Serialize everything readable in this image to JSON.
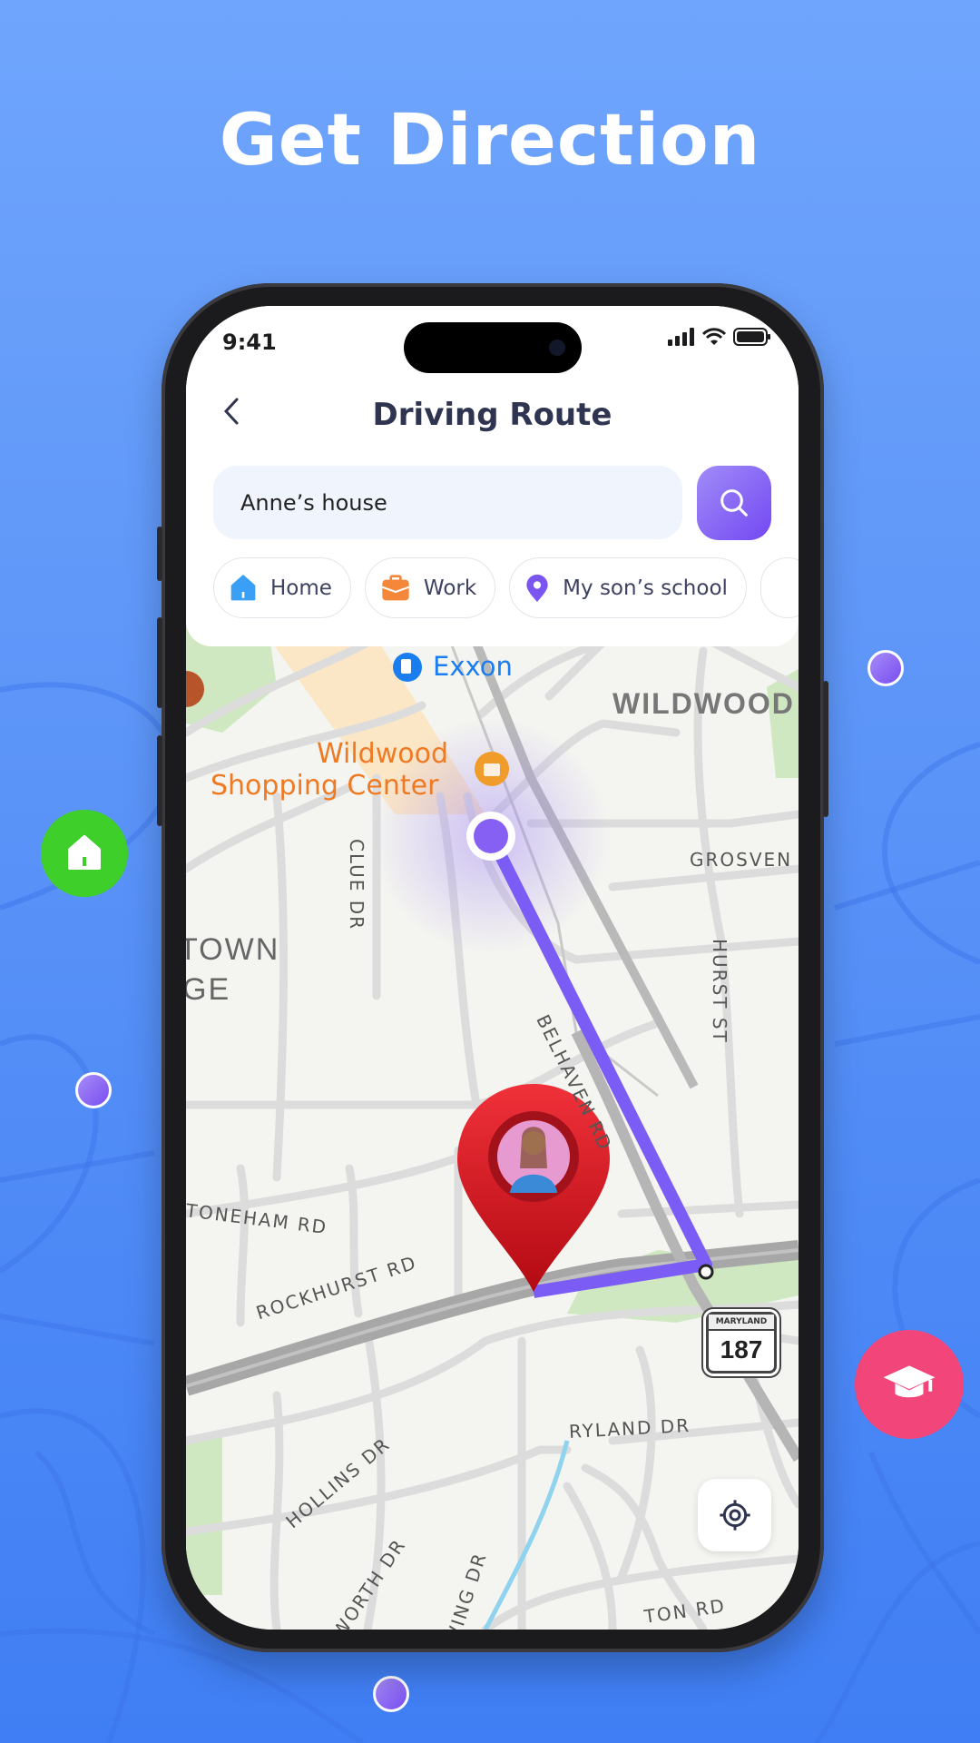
{
  "headline": "Get Direction",
  "status_bar": {
    "time": "9:41",
    "icons": [
      "signal-icon",
      "wifi-icon",
      "battery-icon"
    ]
  },
  "header": {
    "title": "Driving Route",
    "back_icon": "chevron-left-icon"
  },
  "search": {
    "value": "Anne’s house",
    "button_icon": "search-icon"
  },
  "chips": [
    {
      "label": "Home",
      "icon": "home-icon",
      "color": "#3aa0f5"
    },
    {
      "label": "Work",
      "icon": "briefcase-icon",
      "color": "#f5873a"
    },
    {
      "label": "My son’s school",
      "icon": "location-pin-icon",
      "color": "#7b55f0"
    }
  ],
  "map": {
    "labels": {
      "exxon": "Exxon",
      "wildwood": "WILDWOOD",
      "shopping_1": "Wildwood",
      "shopping_2": "Shopping Center",
      "grosven": "GROSVEN",
      "clue": "CLUE DR",
      "town_1": "TOWN",
      "town_2": "GE",
      "hurst": "HURST ST",
      "belhaven": "BELHAVEN RD",
      "toneham": "TONEHAM RD",
      "rockhurst": "ROCKHURST RD",
      "ryland": "RYLAND DR",
      "hollins": "HOLLINS DR",
      "osworth": "OSWORTH DR",
      "wing": "WING DR",
      "ton": "TON RD"
    },
    "route_shield": {
      "state": "MARYLAND",
      "number": "187"
    },
    "route_color": "#7b5cf5",
    "pin_color": "#d9141e"
  },
  "floating_icons": [
    {
      "icon": "home-icon",
      "color": "#3fcf2a"
    },
    {
      "icon": "graduation-cap-icon",
      "color": "#f2457a"
    }
  ]
}
